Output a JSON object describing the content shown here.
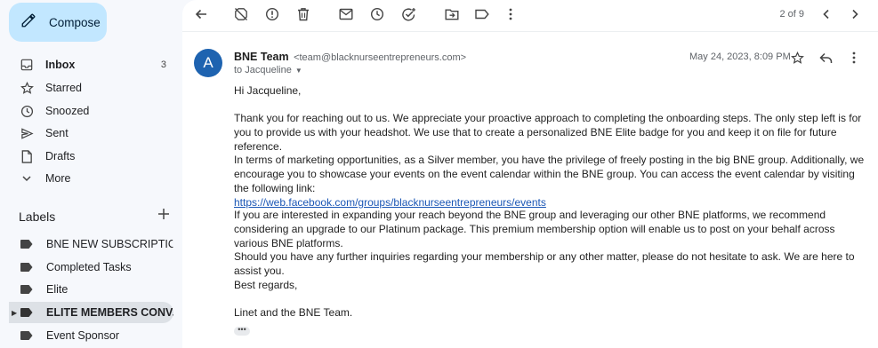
{
  "sidebar": {
    "compose_label": "Compose",
    "items": [
      {
        "label": "Inbox",
        "count": "3",
        "icon": "inbox-icon"
      },
      {
        "label": "Starred",
        "icon": "star-icon"
      },
      {
        "label": "Snoozed",
        "icon": "clock-icon"
      },
      {
        "label": "Sent",
        "icon": "send-icon"
      },
      {
        "label": "Drafts",
        "icon": "draft-icon"
      },
      {
        "label": "More",
        "icon": "chevron-down-icon"
      }
    ],
    "labels_heading": "Labels",
    "labels": [
      {
        "label": "BNE NEW SUBSCRIPTIO..."
      },
      {
        "label": "Completed Tasks"
      },
      {
        "label": "Elite"
      },
      {
        "label": "ELITE MEMBERS CONV..."
      },
      {
        "label": "Event Sponsor"
      }
    ]
  },
  "toolbar": {
    "pager": "2 of 9"
  },
  "message": {
    "avatar_letter": "A",
    "sender_name": "BNE Team",
    "sender_email": "<team@blacknurseentrepreneurs.com>",
    "to_line": "to Jacqueline",
    "date": "May 24, 2023, 8:09 PM",
    "greeting": "Hi Jacqueline,",
    "para1": "Thank you for reaching out to us. We appreciate your proactive approach to completing the onboarding steps. The only step left is for you to provide us with your headshot. We use that to create a personalized BNE Elite badge for you and keep it on file for future reference.",
    "para2": "In terms of marketing opportunities, as a Silver member, you have the privilege of freely posting in the big BNE group. Additionally, we encourage you to showcase your events on the event calendar within the BNE  group. You can access the event calendar by visiting the following link:",
    "link": "https://web.facebook.com/groups/blacknurseentrepreneurs/events",
    "para3": "If you are interested in expanding your reach beyond the BNE group and leveraging our other BNE platforms, we recommend considering an upgrade to our Platinum package. This premium membership option will enable us to post on your behalf across various BNE platforms.",
    "para4": "Should you have any further inquiries regarding your membership or any other matter, please do not hesitate to ask. We are here to assist you.",
    "closing": "Best regards,",
    "signature": "Linet and the BNE Team.",
    "more_label": "•••"
  }
}
